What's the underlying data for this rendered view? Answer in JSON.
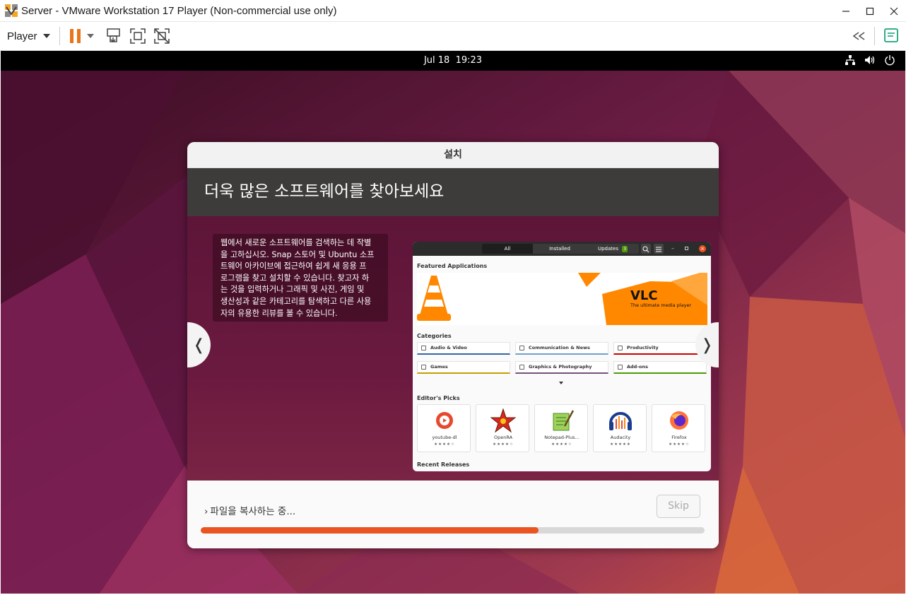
{
  "window": {
    "title": "Server - VMware Workstation 17 Player (Non-commercial use only)",
    "controls": [
      "minimize-icon",
      "maximize-icon",
      "close-icon"
    ]
  },
  "toolbar": {
    "player_label": "Player",
    "icons": [
      "pause-icon",
      "send-ctrl-alt-del-icon",
      "full-screen-icon",
      "unity-icon",
      "back-icon",
      "notes-icon"
    ]
  },
  "ubuntu_topbar": {
    "date": "Jul 18",
    "time": "19:23",
    "tray_icons": [
      "network-icon",
      "volume-icon",
      "power-icon"
    ]
  },
  "installer": {
    "window_title": "설치",
    "slide_title": "더욱 많은 소프트웨어를 찾아보세요",
    "slide_text_lines": [
      "웹에서 새로운 소프트웨어를 검색하는 데 작별",
      "을 고하십시오. Snap 스토어 및 Ubuntu 소프",
      "트웨어 아카이브에 접근하여 쉽게 새 응용 프",
      "로그램을 찾고 설치할 수 있습니다. 찾고자 하",
      "는 것을 입력하거나 그래픽 및 사진, 게임 및",
      "생산성과 같은 카테고리를 탐색하고 다른 사용",
      "자의 유용한 리뷰를 볼 수 있습니다."
    ],
    "prev_arrow": "❬",
    "next_arrow": "❭",
    "progress_label": "파일을 복사하는 중...",
    "progress_caret": "›",
    "skip_label": "Skip",
    "progress_fraction": 0.67
  },
  "software_screenshot": {
    "tabs": [
      "All",
      "Installed",
      "Updates"
    ],
    "updates_count": "3",
    "featured_heading": "Featured Applications",
    "featured_name": "VLC",
    "featured_tagline": "The ultimate media player",
    "categories_heading": "Categories",
    "categories": [
      "Audio & Video",
      "Communication & News",
      "Productivity",
      "Games",
      "Graphics & Photography",
      "Add-ons"
    ],
    "category_colors": [
      "#3465a4",
      "#729fcf",
      "#cc0000",
      "#c4a000",
      "#75507b",
      "#4e9a06"
    ],
    "picks_heading": "Editor's Picks",
    "picks": [
      {
        "name": "youtube-dl",
        "stars": "★★★★☆"
      },
      {
        "name": "OpenRA",
        "stars": "★★★★☆"
      },
      {
        "name": "Notepad-Plus...",
        "stars": "★★★★☆"
      },
      {
        "name": "Audacity",
        "stars": "★★★★★"
      },
      {
        "name": "Firefox",
        "stars": "★★★★☆"
      }
    ],
    "recent_heading": "Recent Releases"
  }
}
